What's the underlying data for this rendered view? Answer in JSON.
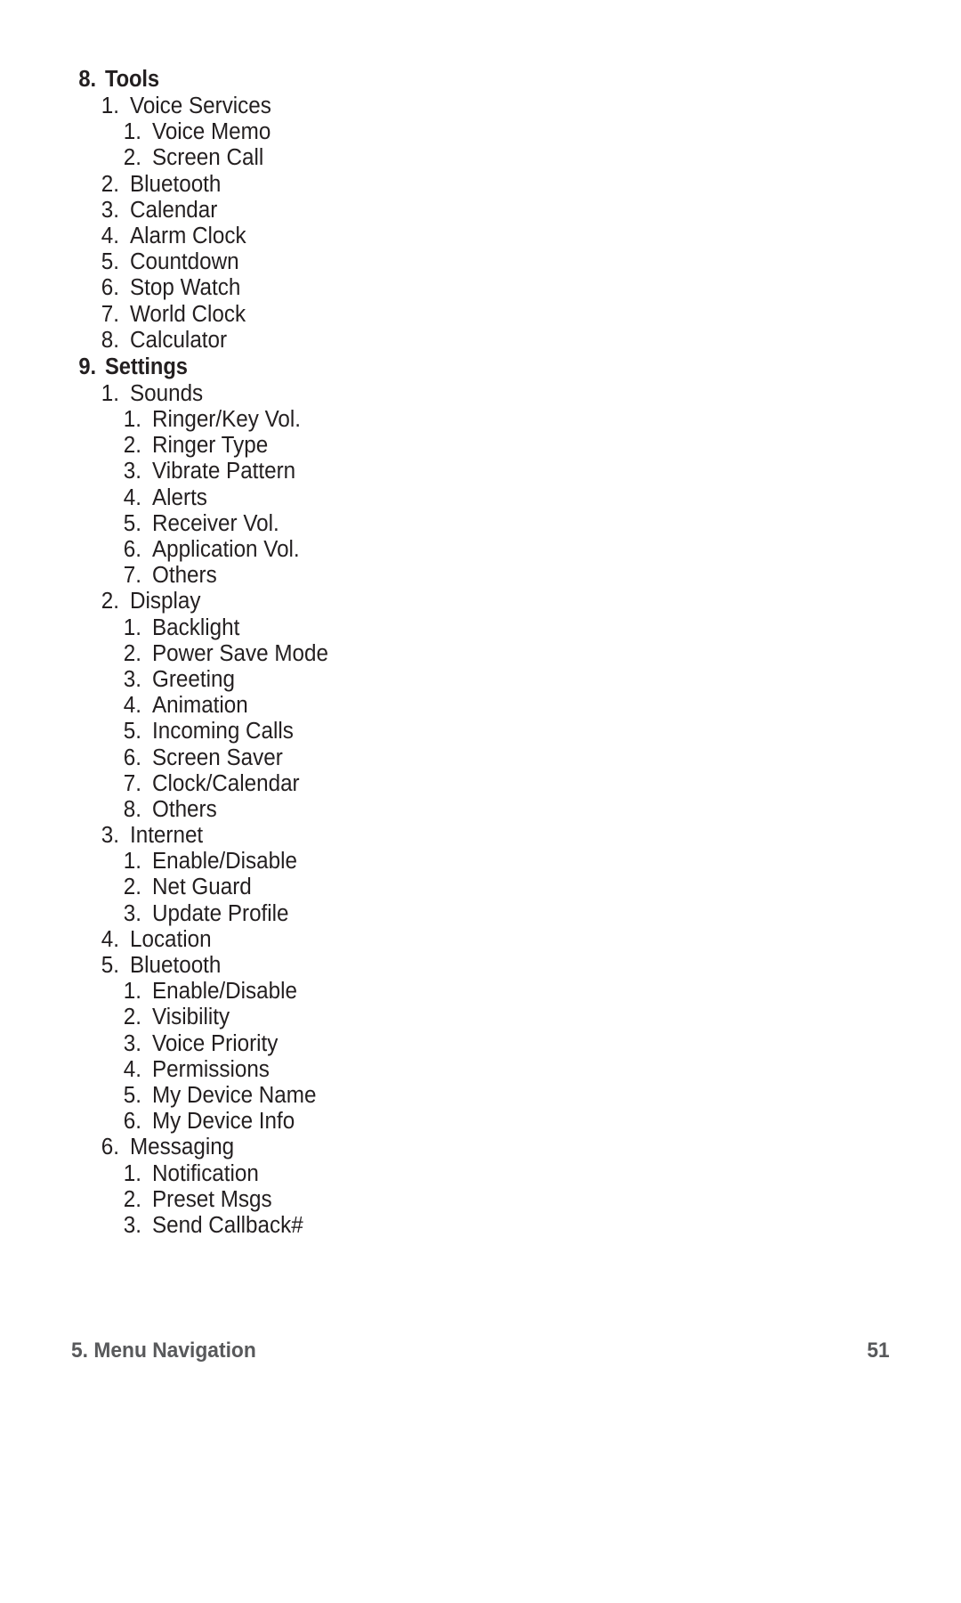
{
  "document": {
    "page_number": "51",
    "footer_chapter": "5. Menu Navigation"
  },
  "outline": [
    {
      "level": 1,
      "number": "8.",
      "label": "Tools"
    },
    {
      "level": 2,
      "number": "1.",
      "label": "Voice Services"
    },
    {
      "level": 3,
      "number": "1.",
      "label": "Voice Memo"
    },
    {
      "level": 3,
      "number": "2.",
      "label": "Screen Call"
    },
    {
      "level": 2,
      "number": "2.",
      "label": "Bluetooth"
    },
    {
      "level": 2,
      "number": "3.",
      "label": "Calendar"
    },
    {
      "level": 2,
      "number": "4.",
      "label": "Alarm Clock"
    },
    {
      "level": 2,
      "number": "5.",
      "label": "Countdown"
    },
    {
      "level": 2,
      "number": "6.",
      "label": "Stop Watch"
    },
    {
      "level": 2,
      "number": "7.",
      "label": "World Clock"
    },
    {
      "level": 2,
      "number": "8.",
      "label": "Calculator"
    },
    {
      "level": 1,
      "number": "9.",
      "label": "Settings"
    },
    {
      "level": 2,
      "number": "1.",
      "label": "Sounds"
    },
    {
      "level": 3,
      "number": "1.",
      "label": "Ringer/Key Vol."
    },
    {
      "level": 3,
      "number": "2.",
      "label": "Ringer Type"
    },
    {
      "level": 3,
      "number": "3.",
      "label": "Vibrate Pattern"
    },
    {
      "level": 3,
      "number": "4.",
      "label": "Alerts"
    },
    {
      "level": 3,
      "number": "5.",
      "label": "Receiver Vol."
    },
    {
      "level": 3,
      "number": "6.",
      "label": "Application Vol."
    },
    {
      "level": 3,
      "number": "7.",
      "label": "Others"
    },
    {
      "level": 2,
      "number": "2.",
      "label": "Display"
    },
    {
      "level": 3,
      "number": "1.",
      "label": "Backlight"
    },
    {
      "level": 3,
      "number": "2.",
      "label": "Power Save Mode"
    },
    {
      "level": 3,
      "number": "3.",
      "label": "Greeting"
    },
    {
      "level": 3,
      "number": "4.",
      "label": "Animation"
    },
    {
      "level": 3,
      "number": "5.",
      "label": "Incoming Calls"
    },
    {
      "level": 3,
      "number": "6.",
      "label": "Screen Saver"
    },
    {
      "level": 3,
      "number": "7.",
      "label": "Clock/Calendar"
    },
    {
      "level": 3,
      "number": "8.",
      "label": "Others"
    },
    {
      "level": 2,
      "number": "3.",
      "label": "Internet"
    },
    {
      "level": 3,
      "number": "1.",
      "label": "Enable/Disable"
    },
    {
      "level": 3,
      "number": "2.",
      "label": "Net Guard"
    },
    {
      "level": 3,
      "number": "3.",
      "label": "Update Profile"
    },
    {
      "level": 2,
      "number": "4.",
      "label": "Location"
    },
    {
      "level": 2,
      "number": "5.",
      "label": "Bluetooth"
    },
    {
      "level": 3,
      "number": "1.",
      "label": "Enable/Disable"
    },
    {
      "level": 3,
      "number": "2.",
      "label": "Visibility"
    },
    {
      "level": 3,
      "number": "3.",
      "label": "Voice Priority"
    },
    {
      "level": 3,
      "number": "4.",
      "label": "Permissions"
    },
    {
      "level": 3,
      "number": "5.",
      "label": "My Device Name"
    },
    {
      "level": 3,
      "number": "6.",
      "label": "My Device Info"
    },
    {
      "level": 2,
      "number": "6.",
      "label": "Messaging"
    },
    {
      "level": 3,
      "number": "1.",
      "label": "Notification"
    },
    {
      "level": 3,
      "number": "2.",
      "label": "Preset Msgs"
    },
    {
      "level": 3,
      "number": "3.",
      "label": "Send Callback#"
    }
  ],
  "colors": {
    "text": "#231f20",
    "footer_text": "#58595b",
    "page_background": "#ffffff"
  }
}
